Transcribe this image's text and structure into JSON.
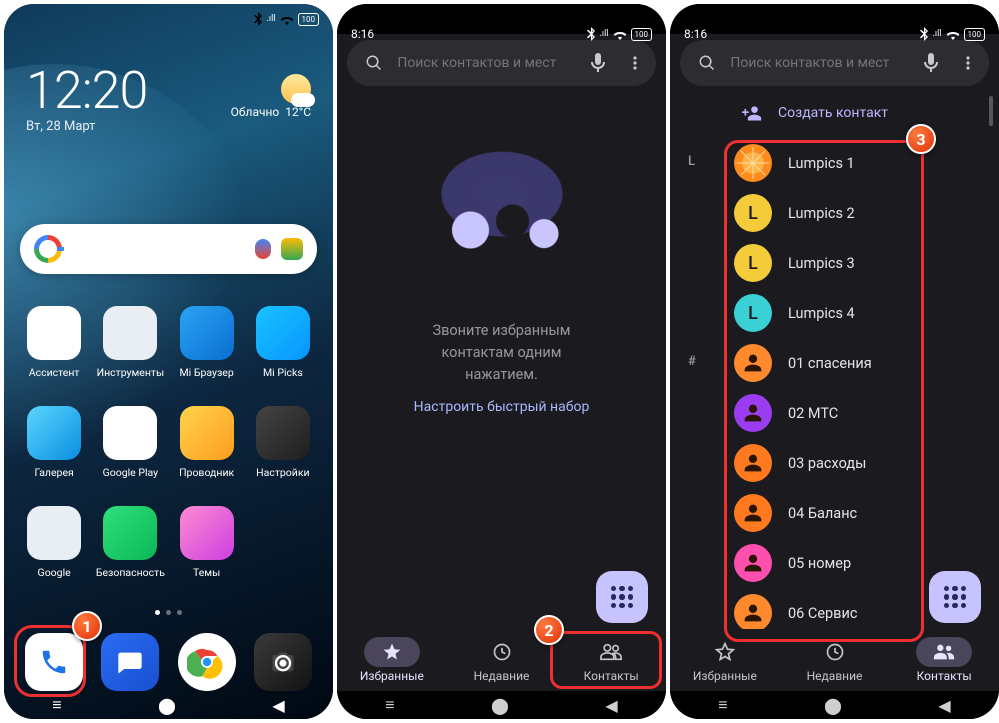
{
  "home": {
    "time": "12:20",
    "date": "Вт, 28 Март",
    "weather": {
      "cond": "Облачно",
      "temp": "12°C"
    },
    "battery": "100",
    "apps_row1": [
      {
        "label": "Ассистент",
        "bg": "#ffffff"
      },
      {
        "label": "Инструменты",
        "bg": "#e8eef4"
      },
      {
        "label": "Mi Браузер",
        "bg": "linear-gradient(135deg,#2aa4f4,#0a6ed1)"
      },
      {
        "label": "Mi Picks",
        "bg": "linear-gradient(135deg,#19c3ff,#0795ff)"
      }
    ],
    "apps_row2": [
      {
        "label": "Галерея",
        "bg": "linear-gradient(135deg,#5bd5ff,#0a8fe0)"
      },
      {
        "label": "Google Play",
        "bg": "#ffffff"
      },
      {
        "label": "Проводник",
        "bg": "linear-gradient(135deg,#ffd34d,#ff9d1e)"
      },
      {
        "label": "Настройки",
        "bg": "linear-gradient(135deg,#444,#1e1e1e)"
      }
    ],
    "apps_row3": [
      {
        "label": "Google",
        "bg": "#e8eef4"
      },
      {
        "label": "Безопасность",
        "bg": "linear-gradient(135deg,#2fe07b,#0bb757)"
      },
      {
        "label": "Темы",
        "bg": "linear-gradient(135deg,#ff8bd1,#cc3fe0)"
      },
      {
        "label": "",
        "bg": ""
      }
    ]
  },
  "phoneapp": {
    "time": "8:16",
    "battery": "100",
    "search_placeholder": "Поиск контактов и мест",
    "empty_line1": "Звоните избранным",
    "empty_line2": "контактам одним",
    "empty_line3": "нажатием.",
    "quick_setup": "Настроить быстрый набор",
    "tabs": {
      "fav": "Избранные",
      "recent": "Недавние",
      "contacts": "Контакты"
    }
  },
  "contacts": {
    "create": "Создать контакт",
    "sections": [
      {
        "letter": "L",
        "items": [
          {
            "name": "Lumpics 1",
            "avatar": "orange-slice",
            "color": "#ff9a2e"
          },
          {
            "name": "Lumpics 2",
            "avatar": "L",
            "color": "#f4cc3a"
          },
          {
            "name": "Lumpics 3",
            "avatar": "L",
            "color": "#f4cc3a"
          },
          {
            "name": "Lumpics 4",
            "avatar": "L",
            "color": "#39d0d6"
          }
        ]
      },
      {
        "letter": "#",
        "items": [
          {
            "name": "01 спасения",
            "avatar": "person",
            "color": "#ff8a2e"
          },
          {
            "name": "02 МТС",
            "avatar": "person",
            "color": "#9a3df0"
          },
          {
            "name": "03 расходы",
            "avatar": "person",
            "color": "#ff7a1e"
          },
          {
            "name": "04 Баланс",
            "avatar": "person",
            "color": "#ff7a1e"
          },
          {
            "name": "05 номер",
            "avatar": "person",
            "color": "#ff4fae"
          },
          {
            "name": "06 Сервис",
            "avatar": "person",
            "color": "#ff8a2e"
          }
        ]
      }
    ]
  },
  "callouts": {
    "b1": "1",
    "b2": "2",
    "b3": "3"
  }
}
